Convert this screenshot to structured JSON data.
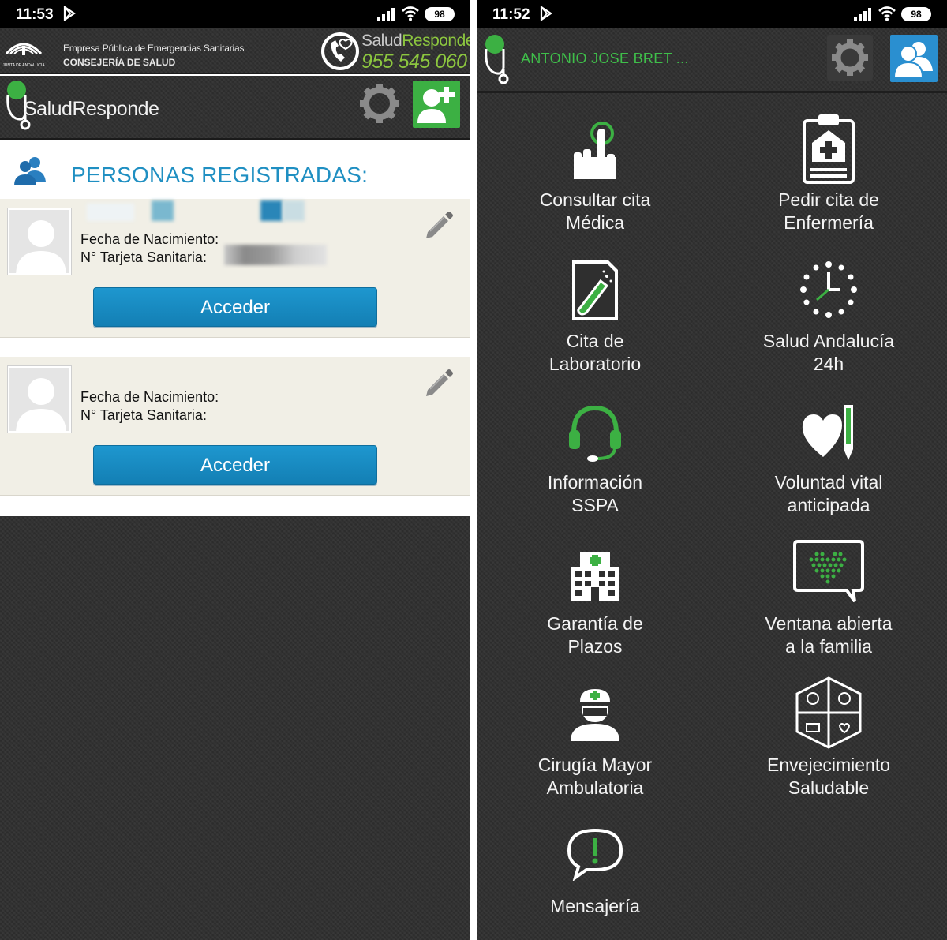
{
  "left_screen": {
    "status": {
      "time": "11:53",
      "battery": "98"
    },
    "gov_header": {
      "junta_text": "JUNTA DE ANDALUCIA",
      "line1": "Empresa Pública de Emergencias Sanitarias",
      "line2": "CONSEJERÍA DE SALUD",
      "brand_a": "Salud",
      "brand_b": "Responde",
      "phone": "955 545 060"
    },
    "app_bar": {
      "brand": "SaludResponde"
    },
    "section_title": "PERSONAS REGISTRADAS:",
    "persons": [
      {
        "birth_label": "Fecha de Nacimiento:",
        "card_label": "N° Tarjeta Sanitaria:",
        "button": "Acceder"
      },
      {
        "birth_label": "Fecha de Nacimiento:",
        "card_label": "N° Tarjeta Sanitaria:",
        "button": "Acceder"
      }
    ]
  },
  "right_screen": {
    "status": {
      "time": "11:52",
      "battery": "98"
    },
    "user_name": "ANTONIO JOSE BRET ...",
    "menu": [
      {
        "line1": "Consultar cita",
        "line2": "Médica",
        "icon": "hand-tap-icon"
      },
      {
        "line1": "Pedir cita de",
        "line2": "Enfermería",
        "icon": "clipboard-cross-icon"
      },
      {
        "line1": "Cita de",
        "line2": "Laboratorio",
        "icon": "lab-tube-icon"
      },
      {
        "line1": "Salud Andalucía",
        "line2": "24h",
        "icon": "clock-icon"
      },
      {
        "line1": "Información",
        "line2": "SSPA",
        "icon": "headset-icon"
      },
      {
        "line1": "Voluntad vital",
        "line2": "anticipada",
        "icon": "heart-pen-icon"
      },
      {
        "line1": "Garantía de",
        "line2": "Plazos",
        "icon": "hospital-icon"
      },
      {
        "line1": "Ventana abierta",
        "line2": "a la familia",
        "icon": "heart-dots-icon"
      },
      {
        "line1": "Cirugía Mayor",
        "line2": "Ambulatoria",
        "icon": "surgeon-icon"
      },
      {
        "line1": "Envejecimiento",
        "line2": "Saludable",
        "icon": "hex-grid-icon"
      },
      {
        "line1": "Mensajería",
        "line2": "",
        "icon": "message-alert-icon"
      }
    ]
  },
  "colors": {
    "accent_green": "#3cb043",
    "accent_blue": "#1f8fc2",
    "dark_bg": "#2f2f2f",
    "card_bg": "#f1efe6"
  }
}
